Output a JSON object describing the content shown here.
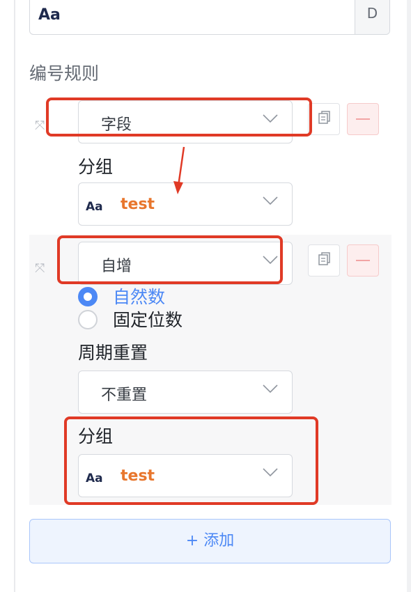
{
  "top_field": {
    "type_icon": "Aa",
    "suffix": "D"
  },
  "section_title": "编号规则",
  "rules": [
    {
      "type_select": "字段",
      "group_label": "分组",
      "group_value": "test",
      "group_type_icon": "Aa"
    },
    {
      "type_select": "自增",
      "radio_options": [
        {
          "label": "自然数",
          "selected": true
        },
        {
          "label": "固定位数",
          "selected": false
        }
      ],
      "period_label": "周期重置",
      "period_value": "不重置",
      "group_label": "分组",
      "group_value": "test",
      "group_type_icon": "Aa"
    }
  ],
  "add_button": {
    "icon": "+",
    "label": "添加"
  },
  "colors": {
    "accent": "#4c88f5",
    "highlight": "#e03a26",
    "value": "#e8762d"
  }
}
